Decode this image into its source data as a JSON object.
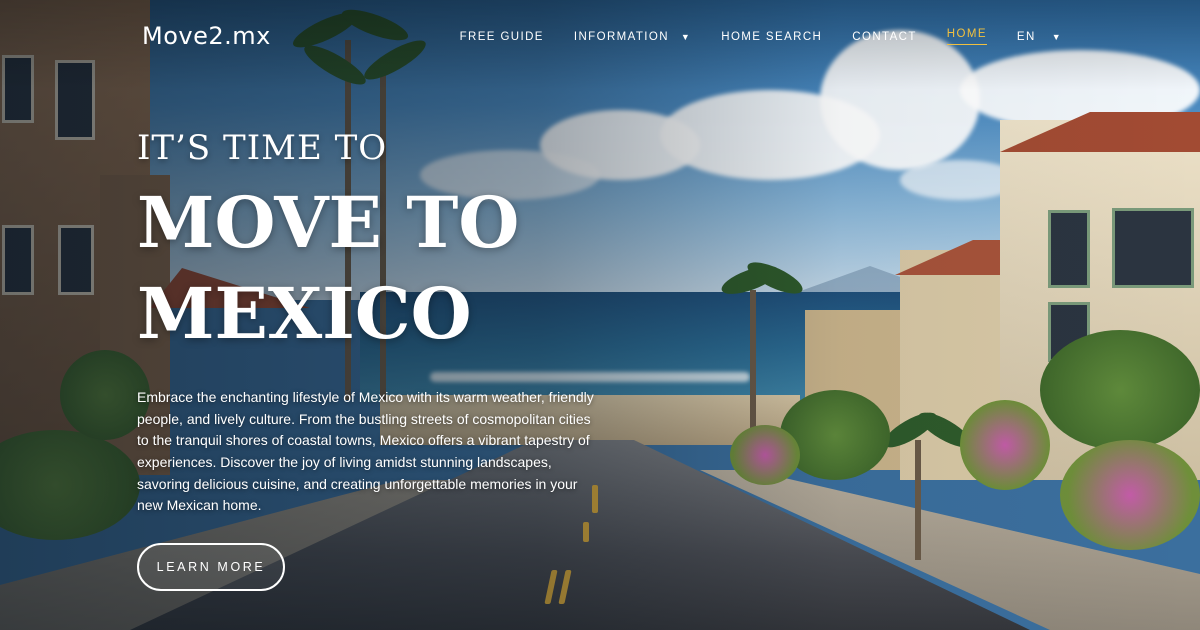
{
  "header": {
    "logo": "Move2.mx",
    "nav": [
      {
        "label": "FREE GUIDE",
        "dropdown": false,
        "active": false
      },
      {
        "label": "INFORMATION",
        "dropdown": true,
        "active": false
      },
      {
        "label": "HOME SEARCH",
        "dropdown": false,
        "active": false
      },
      {
        "label": "CONTACT",
        "dropdown": false,
        "active": false
      },
      {
        "label": "HOME",
        "dropdown": false,
        "active": true
      },
      {
        "label": "EN",
        "dropdown": true,
        "active": false
      }
    ]
  },
  "hero": {
    "kicker": "IT’S TIME TO",
    "headline_line1": "MOVE TO",
    "headline_line2": "MEXICO",
    "description": "Embrace the enchanting lifestyle of Mexico with its warm weather, friendly people, and lively culture. From the bustling streets of cosmopolitan cities to the tranquil shores of coastal towns, Mexico offers a vibrant tapestry of experiences. Discover the joy of living amidst stunning landscapes, savoring delicious cuisine, and creating unforgettable memories in your new Mexican home.",
    "cta_label": "LEARN MORE"
  },
  "icons": {
    "dropdown": "chevron-down-icon"
  },
  "colors": {
    "active_nav": "#f0c040",
    "text": "#ffffff"
  }
}
